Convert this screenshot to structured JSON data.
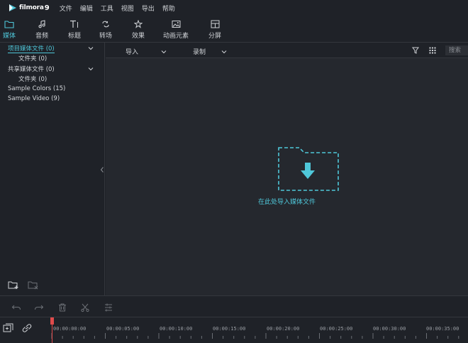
{
  "app": {
    "logo_name": "filmora",
    "logo_version": "9"
  },
  "menu": [
    "文件",
    "编辑",
    "工具",
    "视图",
    "导出",
    "帮助"
  ],
  "toolbar": {
    "tabs": [
      {
        "label": "媒体",
        "icon": "folder-icon",
        "active": true
      },
      {
        "label": "音频",
        "icon": "music-note-icon",
        "active": false
      },
      {
        "label": "标题",
        "icon": "text-title-icon",
        "active": false
      },
      {
        "label": "转场",
        "icon": "transition-icon",
        "active": false
      },
      {
        "label": "效果",
        "icon": "effects-icon",
        "active": false
      },
      {
        "label": "动画元素",
        "icon": "image-elements-icon",
        "active": false
      },
      {
        "label": "分屏",
        "icon": "split-screen-icon",
        "active": false
      }
    ]
  },
  "library": {
    "items": [
      {
        "label": "项目媒体文件 (0)",
        "selected": true
      },
      {
        "label": "文件夹 (0)",
        "selected": false
      },
      {
        "label": "共享媒体文件 (0)",
        "selected": false
      },
      {
        "label": "文件夹 (0)",
        "selected": false
      },
      {
        "label": "Sample Colors (15)",
        "selected": false
      },
      {
        "label": "Sample Video (9)",
        "selected": false
      }
    ]
  },
  "media_toolbar": {
    "import_label": "导入",
    "record_label": "录制",
    "search_placeholder": "搜索"
  },
  "drop_zone": {
    "text": "在此处导入媒体文件"
  },
  "timeline": {
    "timecodes": [
      "00:00:00:00",
      "00:00:05:00",
      "00:00:10:00",
      "00:00:15:00",
      "00:00:20:00",
      "00:00:25:00",
      "00:00:30:00",
      "00:00:35:00"
    ]
  },
  "colors": {
    "accent": "#4fc7d9",
    "background": "#1f2228",
    "panel": "#25282e",
    "playhead": "#e04b4b"
  }
}
